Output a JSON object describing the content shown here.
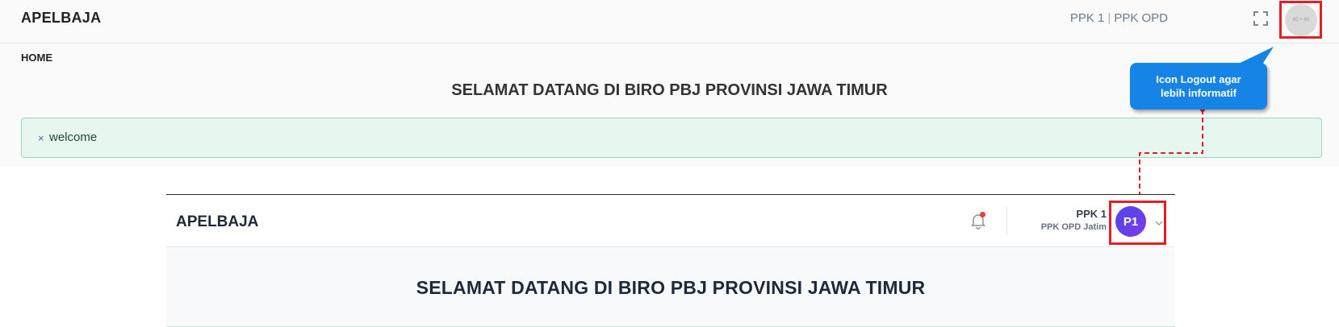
{
  "old_version": {
    "brand": "APELBAJA",
    "user_role": "PPK 1",
    "user_separator": "|",
    "user_org": "PPK OPD",
    "fullscreen_icon": "fullscreen-icon",
    "avatar_placeholder": "60 × 60",
    "breadcrumb": "HOME",
    "page_title": "SELAMAT DATANG DI BIRO PBJ PROVINSI JAWA TIMUR",
    "alert": {
      "close": "×",
      "message": "welcome"
    }
  },
  "callout": {
    "line1": "Icon Logout agar",
    "line2": "lebih informatif"
  },
  "new_version": {
    "brand": "APELBAJA",
    "notification_icon": "bell-icon",
    "user_name": "PPK 1",
    "user_org": "PPK OPD Jatim",
    "avatar_initials": "P1",
    "chevron_icon": "chevron-down-icon",
    "page_title": "SELAMAT DATANG DI BIRO PBJ PROVINSI JAWA TIMUR"
  },
  "colors": {
    "highlight": "#e41e26",
    "callout": "#1684e6",
    "alert_bg": "#e7f6ef",
    "avatar_gradient_start": "#4f46e5",
    "avatar_gradient_end": "#7c3aed",
    "notification_dot": "#ef3b3b"
  }
}
